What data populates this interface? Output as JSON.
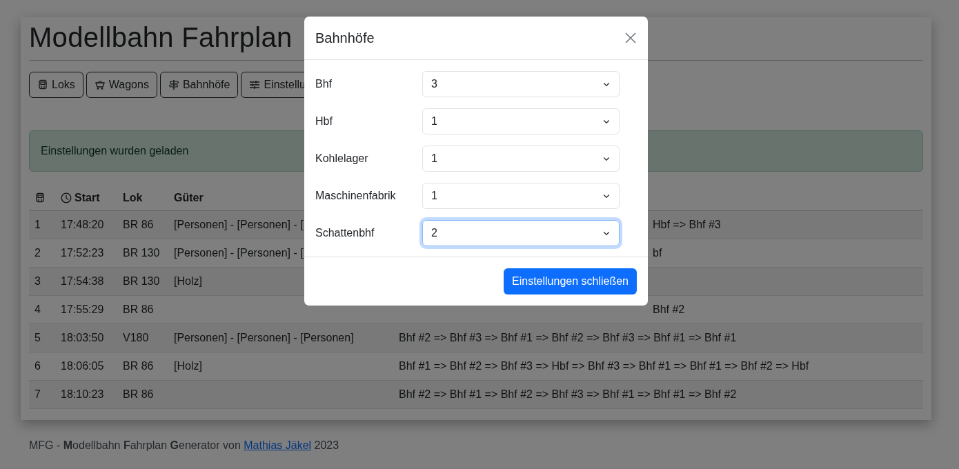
{
  "page": {
    "title": "Modellbahn Fahrplan",
    "nav_buttons": [
      {
        "label": "Loks",
        "kind": "train"
      },
      {
        "label": "Wagons",
        "kind": "cart"
      },
      {
        "label": "Bahnhöfe",
        "kind": "signpost"
      },
      {
        "label": "Einstellu",
        "kind": "sliders"
      }
    ],
    "alert": {
      "text": "Einstellungen wurden geladen"
    },
    "table": {
      "columns": [
        {
          "kind": "icon"
        },
        {
          "kind": "clock",
          "label": "Start"
        },
        {
          "kind": "text",
          "label": "Lok"
        },
        {
          "kind": "text",
          "label": "Güter"
        }
      ],
      "rows": [
        {
          "nr": "1",
          "start": "17:48:20",
          "lok": "BR 86",
          "gueter": "[Personen] - [Personen] - [",
          "route": "Hbf => Bhf #3",
          "route_covered": true
        },
        {
          "nr": "2",
          "start": "17:52:23",
          "lok": "BR 130",
          "gueter": "[Personen] - [Personen] - [",
          "route": "bf",
          "route_covered": true
        },
        {
          "nr": "3",
          "start": "17:54:38",
          "lok": "BR 130",
          "gueter": "[Holz]"
        },
        {
          "nr": "4",
          "start": "17:55:29",
          "lok": "BR 86",
          "route": "Bhf #2",
          "route_covered": true
        },
        {
          "nr": "5",
          "start": "18:03:50",
          "lok": "V180",
          "gueter": "[Personen] - [Personen] - [Personen]",
          "route": "Bhf #2 => Bhf #3 => Bhf #1 => Bhf #2 => Bhf #3 => Bhf #1 => Bhf #1",
          "route_covered": false
        },
        {
          "nr": "6",
          "start": "18:06:05",
          "lok": "BR 86",
          "gueter": "[Holz]",
          "route": "Bhf #1 => Bhf #2 => Bhf #3 => Hbf => Bhf #3 => Bhf #1 => Bhf #1 => Bhf #2 => Hbf",
          "route_covered": false
        },
        {
          "nr": "7",
          "start": "18:10:23",
          "lok": "BR 86",
          "route": "Bhf #2 => Bhf #1 => Bhf #2 => Bhf #3 => Bhf #1 => Bhf #1 => Bhf #2",
          "route_covered": false
        }
      ]
    }
  },
  "footer": {
    "text": "MFG - **M**odellbahn **F**ahrplan **G**enerator von",
    "link": "Mathias Jäkel",
    "after": "2023"
  },
  "modal": {
    "title": "Bahnhöfe",
    "fields": [
      {
        "label": "Bhf",
        "value": "3",
        "focused": false
      },
      {
        "label": "Hbf",
        "value": "1",
        "focused": false
      },
      {
        "label": "Kohlelager",
        "value": "1",
        "focused": false
      },
      {
        "label": "Maschinenfabrik",
        "value": "1",
        "focused": false
      },
      {
        "label": "Schattenbhf",
        "value": "2",
        "focused": true
      }
    ],
    "button": "Einstellungen schließen"
  }
}
